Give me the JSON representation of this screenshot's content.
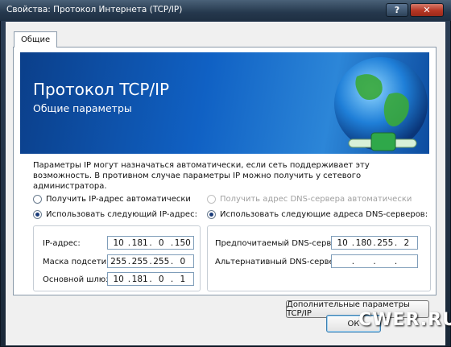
{
  "window": {
    "title": "Свойства: Протокол Интернета (TCP/IP)",
    "help_label": "?",
    "close_label": "✕"
  },
  "tabs": [
    {
      "label": "Общие"
    }
  ],
  "banner": {
    "title": "Протокол TCP/IP",
    "subtitle": "Общие параметры"
  },
  "description": "Параметры IP могут назначаться автоматически, если сеть поддерживает эту возможность. В противном случае параметры IP можно получить у сетевого администратора.",
  "ip": {
    "auto_label": "Получить IP-адрес автоматически",
    "manual_label": "Использовать следующий IP-адрес:",
    "fields": [
      {
        "label": "IP-адрес:",
        "octets": [
          "10",
          "181",
          "0",
          "150"
        ]
      },
      {
        "label": "Маска подсети:",
        "octets": [
          "255",
          "255",
          "255",
          "0"
        ]
      },
      {
        "label": "Основной шлюз:",
        "octets": [
          "10",
          "181",
          "0",
          "1"
        ]
      }
    ]
  },
  "dns": {
    "auto_label": "Получить адрес DNS-сервера автоматически",
    "manual_label": "Использовать следующие адреса DNS-серверов:",
    "fields": [
      {
        "label": "Предпочитаемый DNS-сервер:",
        "octets": [
          "10",
          "180",
          "255",
          "2"
        ]
      },
      {
        "label": "Альтернативный DNS-сервер:",
        "octets": [
          "",
          "",
          "",
          ""
        ]
      }
    ]
  },
  "advanced_button": "Дополнительные параметры TCP/IP",
  "buttons": {
    "ok": "ОК"
  },
  "watermark": "CWER.RU",
  "colors": {
    "banner": "#1061c4",
    "titlebar": "#25384d",
    "close": "#b53624"
  }
}
